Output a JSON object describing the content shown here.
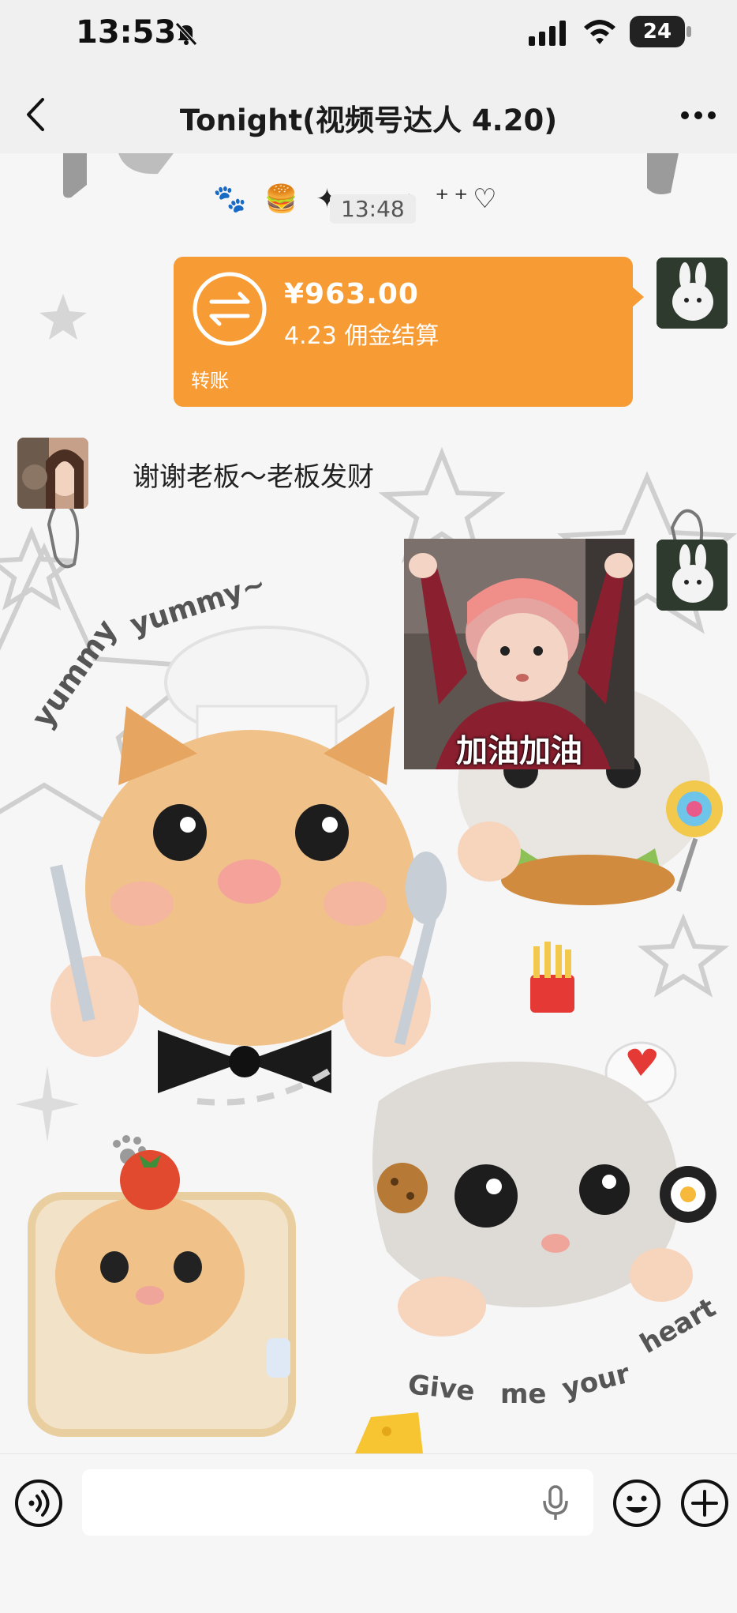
{
  "status_bar": {
    "time": "13:53",
    "battery": "24"
  },
  "nav": {
    "title": "Tonight(视频号达人 4.20)"
  },
  "chat": {
    "header_icons_text": "🐾 🍔 ✦ ☁ • ⁺⁺♡",
    "timestamp": "13:48",
    "transfer": {
      "amount": "¥963.00",
      "memo": "4.23 佣金结算",
      "label": "转账"
    },
    "reply_text": "谢谢老板～老板发财",
    "photo_caption": "加油加油",
    "background_text": {
      "yummy": "yummy yummy~",
      "heart": "Give me your heart"
    }
  },
  "colors": {
    "transfer_orange": "#f79c35",
    "bar_gray": "#f0f0f0"
  },
  "icons": [
    "back-arrow-icon",
    "more-dots-icon",
    "mute-bell-icon",
    "signal-icon",
    "wifi-icon",
    "battery-icon",
    "transfer-icon",
    "voice-icon",
    "mic-icon",
    "emoji-icon",
    "plus-icon"
  ]
}
